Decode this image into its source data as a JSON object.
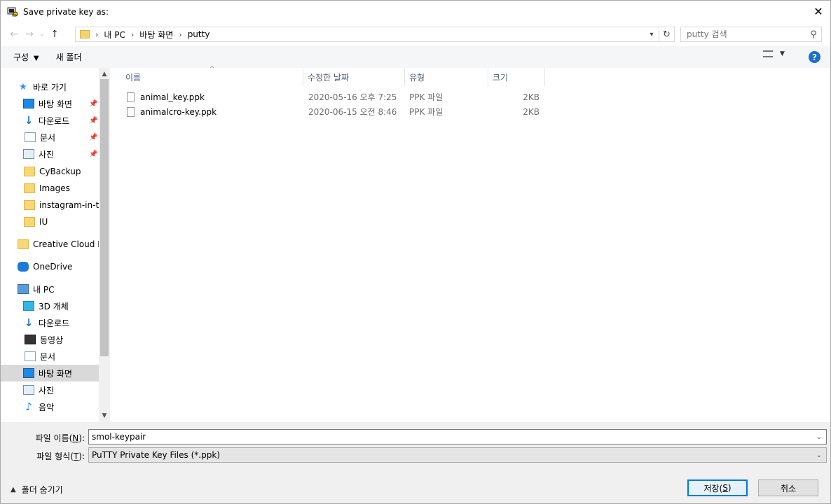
{
  "window": {
    "title": "Save private key as:"
  },
  "address": {
    "crumbs": [
      "내 PC",
      "바탕 화면",
      "putty"
    ]
  },
  "search": {
    "placeholder": "putty 검색"
  },
  "toolbar": {
    "organize": "구성",
    "new_folder": "새 폴더"
  },
  "sidebar": {
    "items": [
      {
        "label": "바로 가기"
      },
      {
        "label": "바탕 화면"
      },
      {
        "label": "다운로드"
      },
      {
        "label": "문서"
      },
      {
        "label": "사진"
      },
      {
        "label": "CyBackup"
      },
      {
        "label": "Images"
      },
      {
        "label": "instagram-in-tis"
      },
      {
        "label": "IU"
      },
      {
        "label": "Creative Cloud Fil"
      },
      {
        "label": "OneDrive"
      },
      {
        "label": "내 PC"
      },
      {
        "label": "3D 개체"
      },
      {
        "label": "다운로드"
      },
      {
        "label": "동영상"
      },
      {
        "label": "문서"
      },
      {
        "label": "바탕 화면"
      },
      {
        "label": "사진"
      },
      {
        "label": "음악"
      }
    ]
  },
  "columns": {
    "name": "이름",
    "date": "수정한 날짜",
    "type": "유형",
    "size": "크기"
  },
  "files": [
    {
      "name": "animal_key.ppk",
      "date": "2020-05-16 오후 7:25",
      "type": "PPK 파일",
      "size": "2KB"
    },
    {
      "name": "animalcro-key.ppk",
      "date": "2020-06-15 오전 8:46",
      "type": "PPK 파일",
      "size": "2KB"
    }
  ],
  "form": {
    "filename_label_pre": "파일 이름(",
    "filename_label_key": "N",
    "filename_label_post": "):",
    "filename_value": "smol-keypair",
    "filetype_label_pre": "파일 형식(",
    "filetype_label_key": "T",
    "filetype_label_post": "):",
    "filetype_value": "PuTTY Private Key Files (*.ppk)"
  },
  "footer": {
    "hide_folders": "폴더 숨기기",
    "save_pre": "저장(",
    "save_key": "S",
    "save_post": ")",
    "cancel": "취소"
  }
}
